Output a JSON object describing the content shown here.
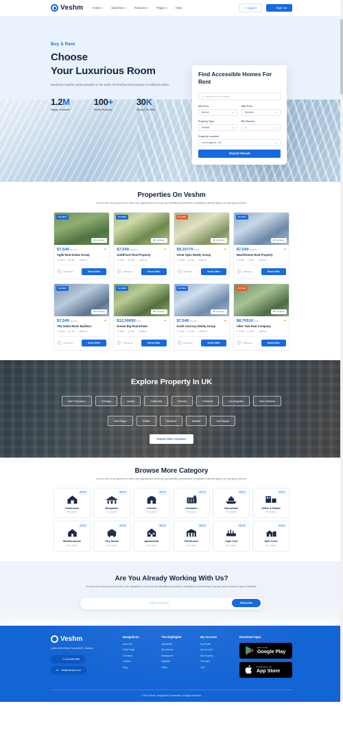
{
  "navbar": {
    "brand": "Veshm",
    "links": [
      {
        "label": "Home",
        "caret": true
      },
      {
        "label": "Searches",
        "caret": true
      },
      {
        "label": "Features",
        "caret": true
      },
      {
        "label": "Pages",
        "caret": true
      },
      {
        "label": "Help",
        "caret": false
      }
    ],
    "login_label": "Log In",
    "signup_label": "Sign Up"
  },
  "hero": {
    "eyebrow": "Buy & Rent",
    "title_line1": "Choose",
    "title_line2": "Your Luxurious Room",
    "subtitle": "Would you explore nature paradise in the world, let't find the best property in California within.",
    "stats": [
      {
        "value": "1.2",
        "unit": "M",
        "label": "Happy Customer"
      },
      {
        "value": "100",
        "unit": "+",
        "label": "Ready Property"
      },
      {
        "value": "30",
        "unit": "K",
        "label": "Google Reviews"
      }
    ]
  },
  "search_card": {
    "title": "Find Accessible Homes For Rent",
    "search_placeholder": "Search for a location",
    "fields": [
      {
        "label": "Min Price",
        "value": "$1000"
      },
      {
        "label": "Max Price",
        "value": "$15000"
      },
      {
        "label": "Property Type",
        "value": "Rental"
      },
      {
        "label": "Bed Rooms",
        "value": "1"
      },
      {
        "label": "Property Location",
        "value": "Los Angeles, CA"
      }
    ],
    "button_label": "Search Result"
  },
  "properties_section": {
    "title": "Properties On Veshm",
    "subtitle": "At vero eos et accusamus et iusto odio dignissimos ducimus qui blanditiis praesentium voluptatum deleniti atque corrupti quos dolores.",
    "cards": [
      {
        "badge": "For Rent",
        "badge_type": "rent",
        "compare": "Compare",
        "price": "$7,549",
        "period": "/Monthly",
        "name": "Agile Real Estate Group",
        "beds": "3 Bed",
        "baths": "2 Ba",
        "area": "3020 sft",
        "agent": "USD/Month",
        "cta": "Send Offer"
      },
      {
        "badge": "For Rent",
        "badge_type": "rent",
        "compare": "Compare",
        "price": "$7,549",
        "period": "/Monthly",
        "name": "GoldFinch Real Property",
        "beds": "3 Bed",
        "baths": "2 Ba",
        "area": "1730 sft",
        "agent": "USD/Month",
        "cta": "Send Offer"
      },
      {
        "badge": "For Sale",
        "badge_type": "sale",
        "compare": "Compare",
        "price": "$9,10770",
        "period": "/USD",
        "name": "Great Apex Realty Group",
        "beds": "4 Bed",
        "baths": "3 Ba",
        "area": "2630 sft",
        "agent": "USD/Month",
        "cta": "Send Offer"
      },
      {
        "badge": "For Rent",
        "badge_type": "rent",
        "compare": "Compare",
        "price": "$7,549",
        "period": "/Monthly",
        "name": "Hearthstone Real Property",
        "beds": "3 Bed",
        "baths": "2 Ba",
        "area": "1220 sft",
        "agent": "USD/Month",
        "cta": "Send Offer"
      },
      {
        "badge": "For Rent",
        "badge_type": "rent",
        "compare": "Compare",
        "price": "$7,549",
        "period": "/Monthly",
        "name": "The Select Brick Builders",
        "beds": "3 Bed",
        "baths": "2 Ba",
        "area": "2010 sft",
        "agent": "USD/Month",
        "cta": "Send Offer"
      },
      {
        "badge": "For Rent",
        "badge_type": "rent",
        "compare": "Compare",
        "price": "$12,50650",
        "period": "/USD",
        "name": "Dream Big Real Estate",
        "beds": "4 Bed",
        "baths": "3 Ba",
        "area": "3100 sft",
        "agent": "USD/Month",
        "cta": "Send Offer"
      },
      {
        "badge": "For Rent",
        "badge_type": "rent",
        "compare": "Compare",
        "price": "$7,549",
        "period": "/Monthly",
        "name": "Kozik And Kay Realty Group",
        "beds": "3 Bed",
        "baths": "2 Ba",
        "area": "1640 sft",
        "agent": "USD/Month",
        "cta": "Send Offer"
      },
      {
        "badge": "For Sale",
        "badge_type": "sale",
        "compare": "Compare",
        "price": "$8,70510",
        "period": "/USD",
        "name": "Allen Tate Real Company",
        "beds": "4 Bed",
        "baths": "3 Ba",
        "area": "2980 sft",
        "agent": "USD/Month",
        "cta": "Send Offer"
      }
    ]
  },
  "explore": {
    "title": "Explore Property In UK",
    "chips_row1": [
      "San Francisco",
      "Chicago",
      "Austin",
      "California",
      "Denver",
      "Portland",
      "Los Angeles",
      "New Orleans"
    ],
    "chips_row2": [
      "San Diego",
      "Dallas",
      "Houston",
      "Atlanta",
      "Las Vegas"
    ],
    "more_label": "Explore More Locations"
  },
  "category_section": {
    "title": "Browse More Category",
    "subtitle": "At vero eos et accusamus et iusto odio dignissimos ducimus qui blanditiis praesentium voluptatum deleniti atque corrupti quos dolores.",
    "items": [
      {
        "badge": "70 List",
        "icon": "townhouse-icon",
        "name": "Townhouse",
        "locations": "06 Locations"
      },
      {
        "badge": "80 List",
        "icon": "bungalow-icon",
        "name": "Bungalow",
        "locations": "04 Locations"
      },
      {
        "badge": "19 List",
        "icon": "condos-icon",
        "name": "Condos",
        "locations": "07 Locations"
      },
      {
        "badge": "22 List",
        "icon": "container-icon",
        "name": "Container",
        "locations": "14 Locations"
      },
      {
        "badge": "42 List",
        "icon": "houseboat-icon",
        "name": "Houseboat",
        "locations": "09 Locations"
      },
      {
        "badge": "15 List",
        "icon": "office-studio-icon",
        "name": "Office & Studio",
        "locations": "23 Locations"
      },
      {
        "badge": "14 List",
        "icon": "mediterranean-icon",
        "name": "Mediterranean",
        "locations": "08 Locations"
      },
      {
        "badge": "27 List",
        "icon": "tiny-house-icon",
        "name": "Tiny House",
        "locations": "06 Locations"
      },
      {
        "badge": "30 List",
        "icon": "apartments-icon",
        "name": "Apartments",
        "locations": "19 Locations"
      },
      {
        "badge": "28 List",
        "icon": "farmhouse-icon",
        "name": "Farmhouse",
        "locations": "12 Locations"
      },
      {
        "badge": "56 List",
        "icon": "cape-cod-icon",
        "name": "Cape Cod",
        "locations": "16 Locations"
      },
      {
        "badge": "40 List",
        "icon": "split-level-icon",
        "name": "Split Level",
        "locations": "10 Locations"
      }
    ]
  },
  "newsletter": {
    "title": "Are You Already Working With Us?",
    "subtitle": "At vero eos et accusamus et iusto odio dignissimos ducimus qui blanditiis praesentium voluptatum deleniti atque corrupti quos dolores et quos molestias.",
    "placeholder": "Enter Your email",
    "button_label": "Subscribe"
  },
  "footer": {
    "brand": "Veshm",
    "address": "Collins Street West, Victoria 8007, Australia",
    "phone": "+1 246-545-0695",
    "email": "info@example.com",
    "columns": [
      {
        "title": "Navigations",
        "links": [
          "About Us",
          "FAQs Page",
          "Checkout",
          "Contact",
          "Blog"
        ]
      },
      {
        "title": "The Highlights",
        "links": [
          "Apartment",
          "My Houses",
          "Restaurant",
          "Nightlife",
          "Villas"
        ]
      },
      {
        "title": "My Account",
        "links": [
          "My Profile",
          "My account",
          "My Property",
          "Favorites",
          "Cart"
        ]
      }
    ],
    "apps_title": "Download Apps",
    "google_sub": "GET IT ON",
    "google_main": "Google Play",
    "apple_sub": "Download on the",
    "apple_main": "App Store",
    "copyright": "© 2023 Veshm. Designed by Themesflat. All Rights Reserved."
  },
  "colors": {
    "accent": "#1769e0",
    "footer_bg": "#1364d4",
    "sale_badge": "#f05a28",
    "dark_text": "#16243f"
  }
}
